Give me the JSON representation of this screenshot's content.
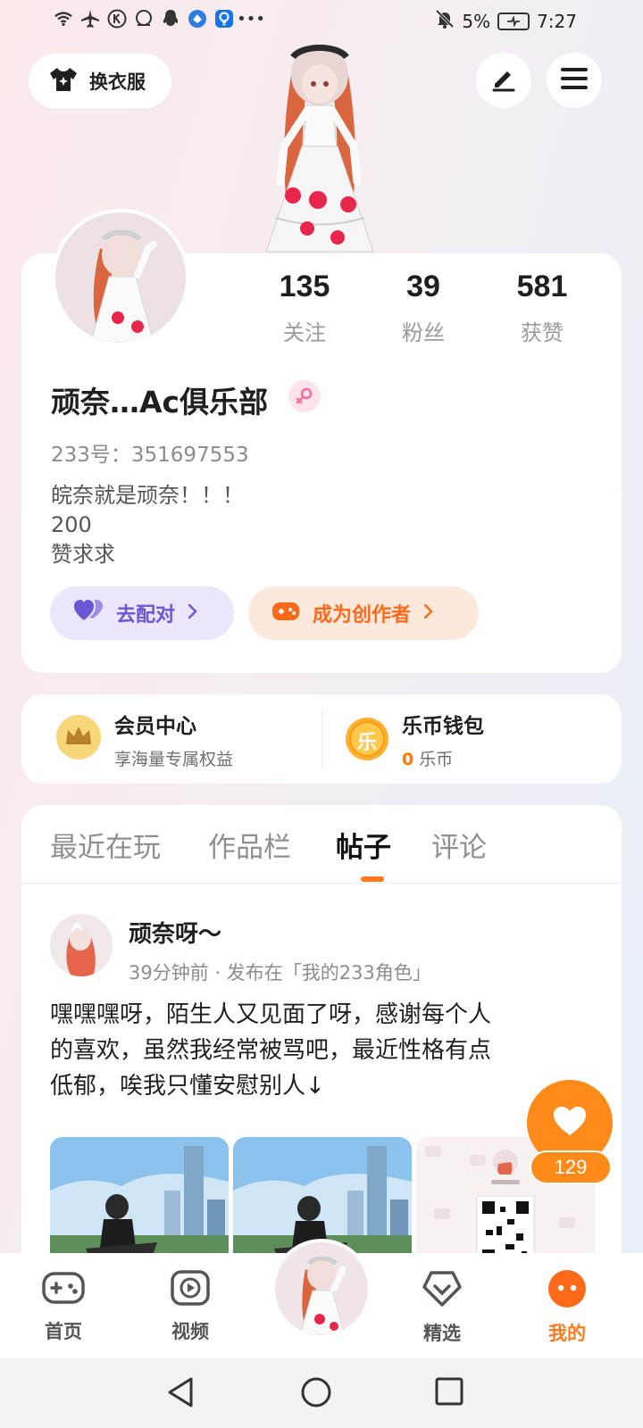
{
  "status_bar": {
    "battery_percent": "5%",
    "time": "7:27"
  },
  "header": {
    "outfit_label": "换衣服"
  },
  "profile": {
    "stats": [
      {
        "count": "135",
        "label": "关注"
      },
      {
        "count": "39",
        "label": "粉丝"
      },
      {
        "count": "581",
        "label": "获赞"
      }
    ],
    "name": "顽奈…Ac俱乐部",
    "uid": "233号：351697553",
    "bio_lines": [
      "皖奈就是顽奈！！！",
      "200",
      "赞求求"
    ],
    "match_label": "去配对",
    "creator_label": "成为创作者"
  },
  "membership": {
    "title": "会员中心",
    "subtitle": "享海量专属权益",
    "coin_badge": "乐",
    "wallet_title": "乐币钱包",
    "wallet_amount": "0",
    "wallet_unit": " 乐币"
  },
  "tabs": [
    {
      "label": "最近在玩",
      "active": false
    },
    {
      "label": "作品栏",
      "active": false
    },
    {
      "label": "帖子",
      "active": true
    },
    {
      "label": "评论",
      "active": false
    }
  ],
  "post": {
    "author": "顽奈呀～",
    "meta": "39分钟前 · 发布在「我的233角色」",
    "text_lines": [
      "嘿嘿嘿呀，陌生人又见面了呀，感谢每个人",
      "的喜欢，虽然我经常被骂吧，最近性格有点",
      "低郁，唉我只懂安慰别人↓"
    ],
    "like_count": "129"
  },
  "bottom_nav": [
    {
      "label": "首页",
      "icon": "gamepad-icon"
    },
    {
      "label": "视频",
      "icon": "play-icon"
    },
    {
      "label": "精选",
      "icon": "heart-shield-icon"
    },
    {
      "label": "我的",
      "icon": "face-icon",
      "active": true
    }
  ],
  "colors": {
    "accent": "#ff7a1a",
    "match_purple": "#6b57d6",
    "match_bg": "#ebe6fb",
    "creator_bg": "#fde8dc"
  }
}
